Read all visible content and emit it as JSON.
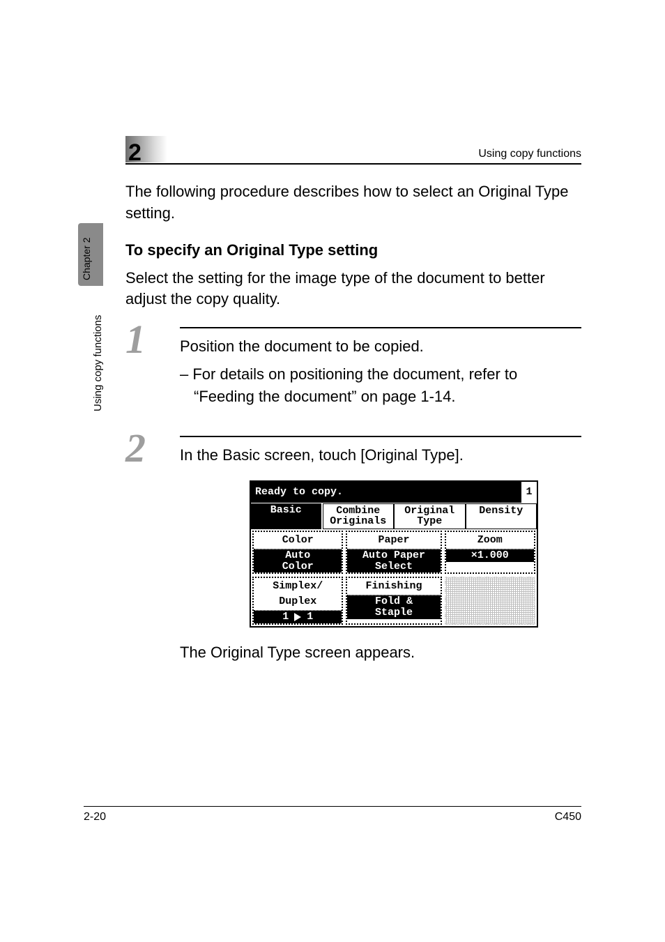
{
  "header": {
    "chapter_number": "2",
    "running_title": "Using copy functions",
    "side_tab": "Chapter 2",
    "side_text": "Using copy functions"
  },
  "intro": "The following procedure describes how to select an Original Type setting.",
  "heading": "To specify an Original Type setting",
  "heading_para": "Select the setting for the image type of the document to better adjust the copy quality.",
  "steps": [
    {
      "num": "1",
      "text": "Position the document to be copied.",
      "sub": "– For details on positioning the document, refer to “Feeding the document” on page 1-14."
    },
    {
      "num": "2",
      "text": "In the Basic screen, touch [Original Type].",
      "after": "The Original Type screen appears."
    }
  ],
  "screenshot": {
    "status": "Ready to copy.",
    "count": "1",
    "tabs": [
      "Basic",
      "Combine\nOriginals",
      "Original\nType",
      "Density"
    ],
    "active_tab": 0,
    "cells": {
      "color_label": "Color",
      "color_value": "Auto\nColor",
      "paper_label": "Paper",
      "paper_value": "Auto Paper\nSelect",
      "zoom_label": "Zoom",
      "zoom_value": "×1.000",
      "simplex_label": "Simplex/\nDuplex",
      "simplex_value_left": "1",
      "simplex_value_right": "1",
      "finishing_label": "Finishing",
      "fold_label": "Fold &\nStaple"
    }
  },
  "footer": {
    "left": "2-20",
    "right": "C450"
  }
}
